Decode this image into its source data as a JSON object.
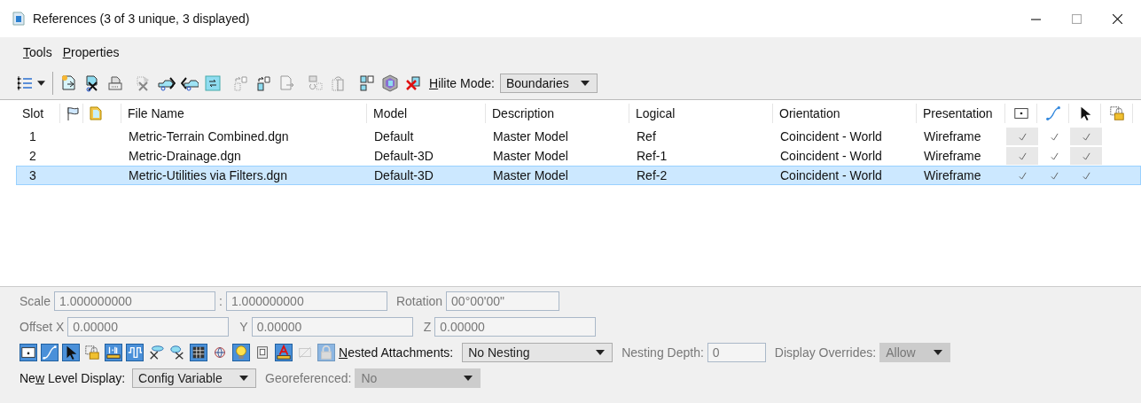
{
  "window": {
    "title": "References (3 of 3 unique, 3 displayed)"
  },
  "menu": [
    {
      "key": "T",
      "post": "ools"
    },
    {
      "key": "P",
      "post": "roperties"
    }
  ],
  "hilite_mode": {
    "label": {
      "key": "H",
      "post": "ilite Mode:"
    },
    "value": "Boundaries"
  },
  "table": {
    "columns": [
      "Slot",
      "File Name",
      "Model",
      "Description",
      "Logical",
      "Orientation",
      "Presentation"
    ],
    "rows": [
      {
        "slot": "1",
        "file_name": "Metric-Terrain Combined.dgn",
        "model": "Default",
        "description": "Master Model",
        "logical": "Ref",
        "orientation": "Coincident - World",
        "presentation": "Wireframe",
        "display": true,
        "snap": true,
        "locate": true,
        "selected": false
      },
      {
        "slot": "2",
        "file_name": "Metric-Drainage.dgn",
        "model": "Default-3D",
        "description": "Master Model",
        "logical": "Ref-1",
        "orientation": "Coincident - World",
        "presentation": "Wireframe",
        "display": true,
        "snap": true,
        "locate": true,
        "selected": false
      },
      {
        "slot": "3",
        "file_name": "Metric-Utilities via Filters.dgn",
        "model": "Default-3D",
        "description": "Master Model",
        "logical": "Ref-2",
        "orientation": "Coincident - World",
        "presentation": "Wireframe",
        "display": true,
        "snap": true,
        "locate": true,
        "selected": true
      }
    ]
  },
  "attachment": {
    "scale": {
      "label": "Scale",
      "value": "1.000000000",
      "disabled": true
    },
    "scale_separator": ":",
    "scale_2": {
      "value": "1.000000000",
      "disabled": true
    },
    "rotation": {
      "label": "Rotation",
      "value": "00°00'00\"",
      "disabled": true
    },
    "offset_x": {
      "label": "Offset X",
      "value": "0.00000",
      "disabled": true
    },
    "offset_y": {
      "label": "Y",
      "value": "0.00000",
      "disabled": true
    },
    "offset_z": {
      "label": "Z",
      "value": "0.00000",
      "disabled": true
    }
  },
  "toggles": [
    {
      "on": true
    },
    {
      "on": true
    },
    {
      "on": true
    },
    {
      "on": false
    },
    {
      "on": true
    },
    {
      "on": true
    },
    {
      "on": false
    },
    {
      "on": false
    },
    {
      "on": true
    },
    {
      "on": false
    },
    {
      "on": true
    },
    {
      "on": false
    },
    {
      "on": true
    },
    {
      "on": false
    },
    {
      "on": true
    }
  ],
  "nested_attachments": {
    "label": {
      "key": "N",
      "post": "ested Attachments:"
    },
    "value": "No Nesting"
  },
  "nesting_depth": {
    "label": "Nesting Depth:",
    "value": "0",
    "disabled": true
  },
  "display_overrides": {
    "label": "Display Overrides:",
    "value": "Allow",
    "disabled": true
  },
  "level_display": {
    "label": {
      "pre": "Ne",
      "key": "w",
      "post": " Level Display:"
    },
    "value": "Config Variable"
  },
  "georeferenced": {
    "label": "Georeferenced:",
    "value": "No",
    "disabled": true
  }
}
